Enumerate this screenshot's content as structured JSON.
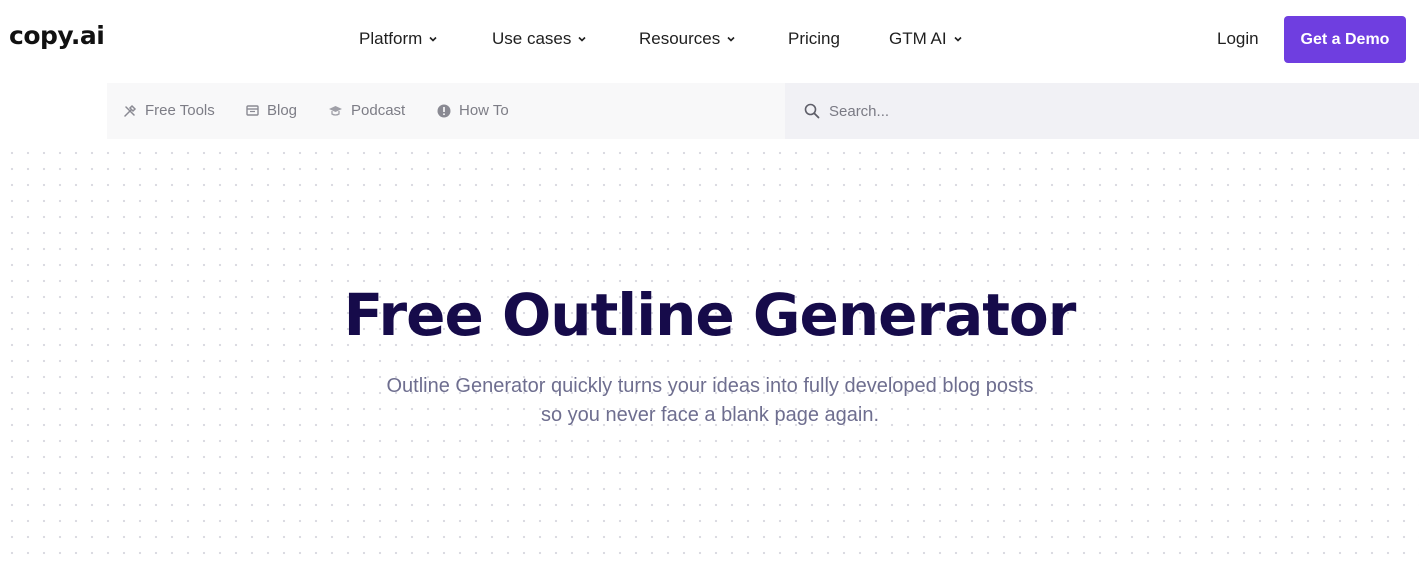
{
  "brand": {
    "logo": "copy.ai"
  },
  "nav": {
    "items": [
      {
        "label": "Platform",
        "has_dropdown": true
      },
      {
        "label": "Use cases",
        "has_dropdown": true
      },
      {
        "label": "Resources",
        "has_dropdown": true
      },
      {
        "label": "Pricing",
        "has_dropdown": false
      },
      {
        "label": "GTM AI",
        "has_dropdown": true
      }
    ],
    "login": "Login",
    "cta": "Get a Demo"
  },
  "subnav": {
    "items": [
      {
        "label": "Free Tools",
        "icon": "tools-icon"
      },
      {
        "label": "Blog",
        "icon": "blog-icon"
      },
      {
        "label": "Podcast",
        "icon": "graduation-cap-icon"
      },
      {
        "label": "How To",
        "icon": "info-circle-icon"
      }
    ],
    "search": {
      "placeholder": "Search...",
      "value": ""
    }
  },
  "hero": {
    "title": "Free Outline Generator",
    "subtitle_line1": "Outline Generator quickly turns your ideas into fully developed blog posts",
    "subtitle_line2": "so you never face a blank page again."
  },
  "colors": {
    "accent": "#6f3ee0",
    "title": "#160b4a",
    "subtitle": "#6e6e8f",
    "subnav_bg": "#f8f8f9",
    "search_bg": "#f1f1f5"
  }
}
